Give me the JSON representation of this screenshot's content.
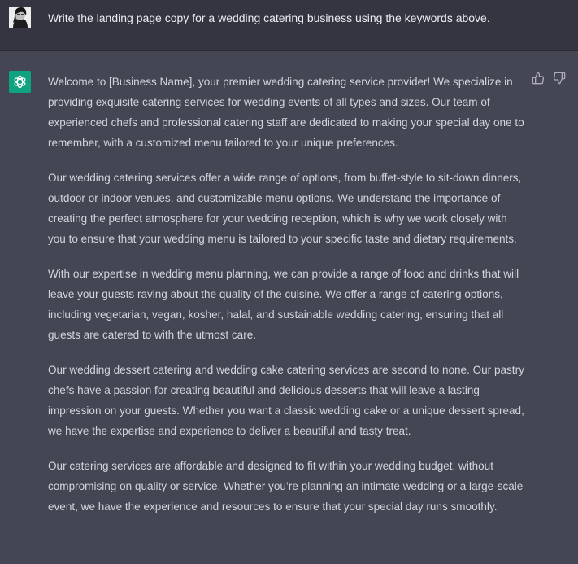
{
  "conversation": {
    "user_message": "Write the landing page copy for a wedding catering business using the keywords above.",
    "assistant_paragraphs": [
      "Welcome to [Business Name], your premier wedding catering service provider! We specialize in providing exquisite catering services for wedding events of all types and sizes. Our team of experienced chefs and professional catering staff are dedicated to making your special day one to remember, with a customized menu tailored to your unique preferences.",
      "Our wedding catering services offer a wide range of options, from buffet-style to sit-down dinners, outdoor or indoor venues, and customizable menu options. We understand the importance of creating the perfect atmosphere for your wedding reception, which is why we work closely with you to ensure that your wedding menu is tailored to your specific taste and dietary requirements.",
      "With our expertise in wedding menu planning, we can provide a range of food and drinks that will leave your guests raving about the quality of the cuisine. We offer a range of catering options, including vegetarian, vegan, kosher, halal, and sustainable wedding catering, ensuring that all guests are catered to with the utmost care.",
      "Our wedding dessert catering and wedding cake catering services are second to none. Our pastry chefs have a passion for creating beautiful and delicious desserts that will leave a lasting impression on your guests. Whether you want a classic wedding cake or a unique dessert spread, we have the expertise and experience to deliver a beautiful and tasty treat.",
      "Our catering services are affordable and designed to fit within your wedding budget, without compromising on quality or service. Whether you’re planning an intimate wedding or a large-scale event, we have the experience and resources to ensure that your special day runs smoothly."
    ]
  },
  "icons": {
    "user_avatar": "user-avatar-photo",
    "assistant_avatar": "openai-logo-icon",
    "thumbs_up": "thumbs-up-icon",
    "thumbs_down": "thumbs-down-icon"
  },
  "colors": {
    "user_row_bg": "#343541",
    "assistant_row_bg": "#444654",
    "brand_green": "#10a37f",
    "text": "#d1d5db"
  }
}
